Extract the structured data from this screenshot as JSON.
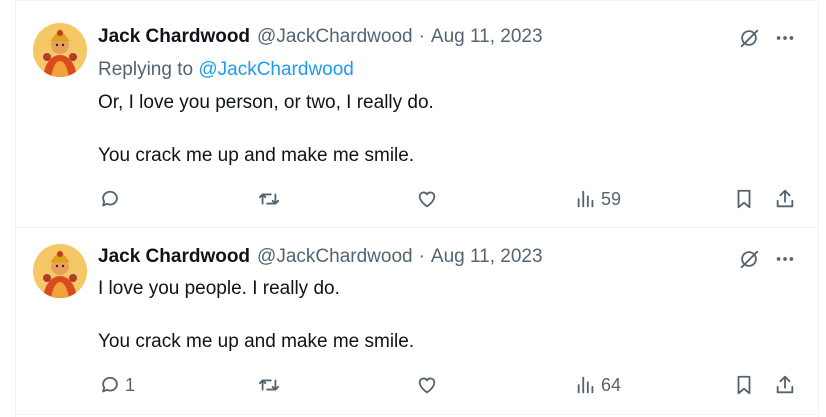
{
  "tweets": [
    {
      "author_name": "Jack Chardwood",
      "handle": "@JackChardwood",
      "separator": "·",
      "date": "Aug 11, 2023",
      "replying_to_prefix": "Replying to ",
      "replying_to_handle": "@JackChardwood",
      "lines": [
        "Or, I love you person, or two, I really do.",
        "You crack me up and make me smile."
      ],
      "reply_count": "",
      "view_count": "59"
    },
    {
      "author_name": "Jack Chardwood",
      "handle": "@JackChardwood",
      "separator": "·",
      "date": "Aug 11, 2023",
      "lines": [
        "I love you people. I really do.",
        "You crack me up and make me smile."
      ],
      "reply_count": "1",
      "view_count": "64"
    }
  ],
  "icons": {
    "reply": "reply-icon",
    "retweet": "retweet-icon",
    "like": "like-icon",
    "views": "views-icon",
    "bookmark": "bookmark-icon",
    "share": "share-icon",
    "grok": "grok-icon",
    "more": "more-icon"
  },
  "colors": {
    "text": "#0f1419",
    "secondary": "#536471",
    "link": "#1d9bf0",
    "border": "#eff3f4"
  }
}
